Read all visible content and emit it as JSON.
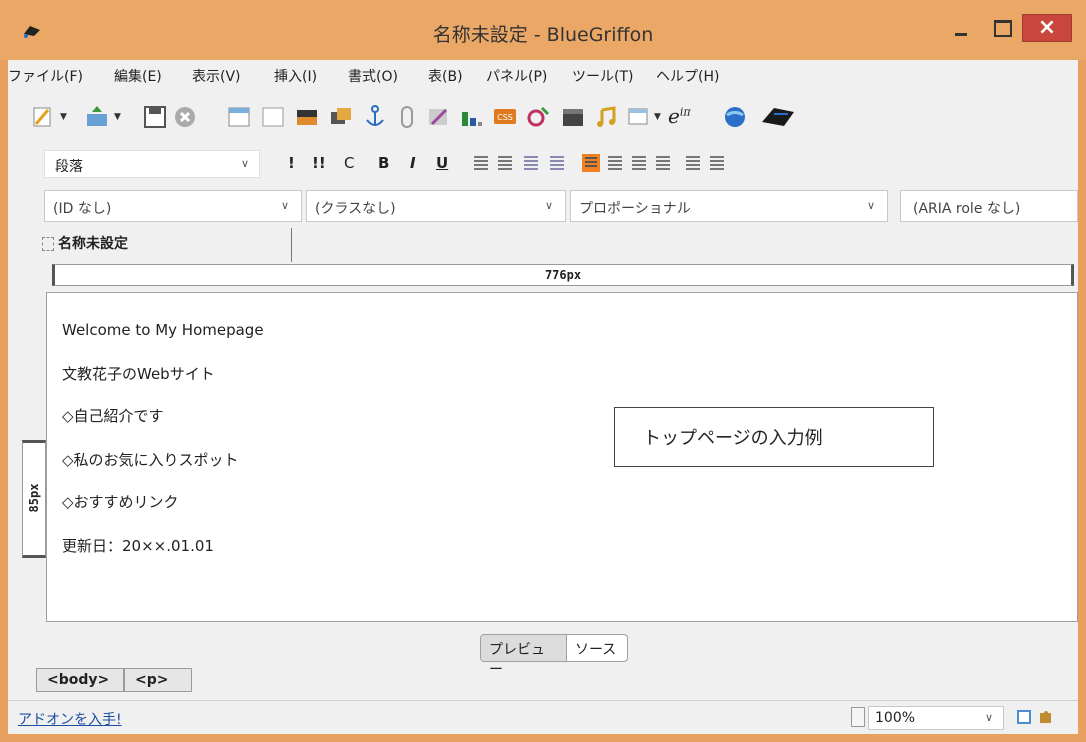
{
  "window": {
    "title": "名称未設定 - BlueGriffon"
  },
  "menu": [
    "ファイル(F)",
    "編集(E)",
    "表示(V)",
    "挿入(I)",
    "書式(O)",
    "表(B)",
    "パネル(P)",
    "ツール(T)",
    "ヘルプ(H)"
  ],
  "toolbar": {
    "math_label": "e",
    "math_exponent": "iπ",
    "css_label": "CSS"
  },
  "format_bar": {
    "paragraph_style": "段落",
    "buttons": [
      "!",
      "!!",
      "C",
      "B",
      "I",
      "U"
    ]
  },
  "attributes_bar": {
    "id_value": "(ID なし)",
    "class_value": "(クラスなし)",
    "font_value": "プロポーショナル",
    "aria_value": "(ARIA role なし)"
  },
  "document_tab": {
    "label": "名称未設定"
  },
  "rulers": {
    "width_label": "776px",
    "height_label": "85px"
  },
  "content": {
    "lines": [
      "Welcome to My Homepage",
      "文教花子のWebサイト",
      "◇自己紹介です",
      "◇私のお気に入りスポット",
      "◇おすすめリンク",
      "更新日：20××.01.01"
    ],
    "callout": "トップページの入力例"
  },
  "view_toggle": {
    "preview": "プレビュー",
    "source": "ソース"
  },
  "breadcrumbs": [
    "<body>",
    "<p>"
  ],
  "statusbar": {
    "addon_link": "アドオンを入手!",
    "zoom": "100%"
  },
  "colors": {
    "titlebar": "#eba766",
    "close_button": "#c9463d",
    "link": "#1a4fa0",
    "active_align": "#f08020"
  }
}
